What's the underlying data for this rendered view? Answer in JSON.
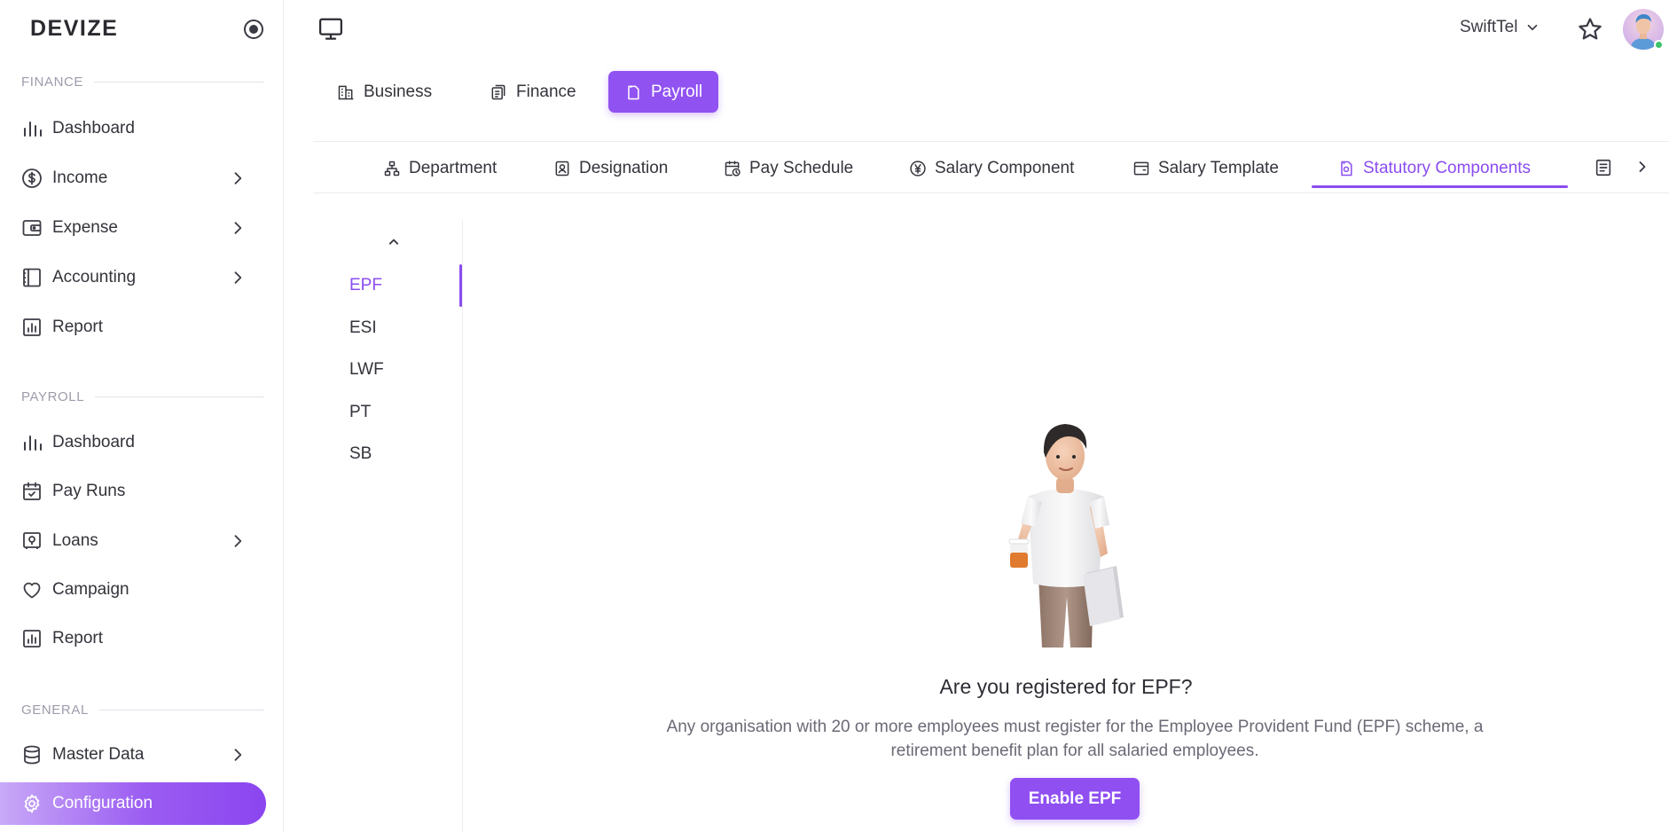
{
  "brand": {
    "name": "DEVIZE"
  },
  "sidebar": {
    "sections": [
      {
        "label": "FINANCE",
        "items": [
          {
            "label": "Dashboard",
            "icon": "bar-chart-icon",
            "has_children": false
          },
          {
            "label": "Income",
            "icon": "dollar-circle-icon",
            "has_children": true
          },
          {
            "label": "Expense",
            "icon": "wallet-icon",
            "has_children": true
          },
          {
            "label": "Accounting",
            "icon": "ledger-icon",
            "has_children": true
          },
          {
            "label": "Report",
            "icon": "report-icon",
            "has_children": false
          }
        ]
      },
      {
        "label": "PAYROLL",
        "items": [
          {
            "label": "Dashboard",
            "icon": "bar-chart-icon",
            "has_children": false
          },
          {
            "label": "Pay Runs",
            "icon": "calendar-check-icon",
            "has_children": false
          },
          {
            "label": "Loans",
            "icon": "safe-icon",
            "has_children": true
          },
          {
            "label": "Campaign",
            "icon": "heart-icon",
            "has_children": false
          },
          {
            "label": "Report",
            "icon": "report-icon",
            "has_children": false
          }
        ]
      },
      {
        "label": "GENERAL",
        "items": [
          {
            "label": "Master Data",
            "icon": "database-icon",
            "has_children": true
          },
          {
            "label": "Configuration",
            "icon": "gear-icon",
            "has_children": false,
            "active": true
          }
        ]
      }
    ]
  },
  "topbar": {
    "org_name": "SwiftTel"
  },
  "module_tabs": [
    {
      "label": "Business",
      "icon": "building-icon"
    },
    {
      "label": "Finance",
      "icon": "documents-icon"
    },
    {
      "label": "Payroll",
      "icon": "payroll-doc-icon",
      "active": true
    }
  ],
  "sub_tabs": [
    {
      "label": "Department",
      "icon": "org-chart-icon"
    },
    {
      "label": "Designation",
      "icon": "id-badge-icon"
    },
    {
      "label": "Pay Schedule",
      "icon": "calendar-clock-icon"
    },
    {
      "label": "Salary Component",
      "icon": "currency-circle-icon"
    },
    {
      "label": "Salary Template",
      "icon": "template-icon"
    },
    {
      "label": "Statutory Components",
      "icon": "shield-doc-icon",
      "active": true
    }
  ],
  "statutory_list": [
    {
      "label": "EPF",
      "active": true
    },
    {
      "label": "ESI"
    },
    {
      "label": "LWF"
    },
    {
      "label": "PT"
    },
    {
      "label": "SB"
    }
  ],
  "content": {
    "heading": "Are you registered for EPF?",
    "description": "Any organisation with 20 or more employees must register for the Employee Provident Fund (EPF) scheme, a retirement benefit plan for all salaried employees.",
    "button_label": "Enable EPF"
  },
  "colors": {
    "accent": "#8b4cf0",
    "accent_button": "#9152f2",
    "online": "#3cc36a"
  }
}
